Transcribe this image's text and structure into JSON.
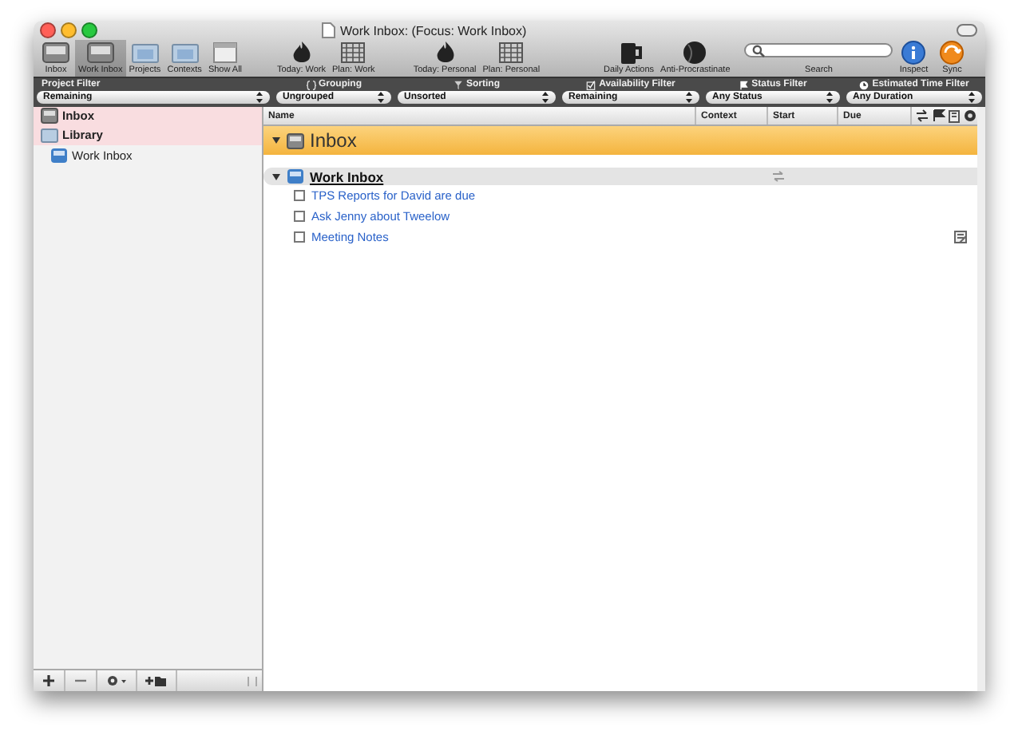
{
  "window": {
    "title": "Work Inbox: (Focus: Work Inbox)"
  },
  "toolbar": {
    "groups": [
      {
        "items": [
          {
            "label": "Inbox",
            "kind": "tray",
            "selected": false
          },
          {
            "label": "Work Inbox",
            "kind": "tray",
            "selected": true
          },
          {
            "label": "Projects",
            "kind": "folder",
            "selected": false
          },
          {
            "label": "Contexts",
            "kind": "folder",
            "selected": false
          },
          {
            "label": "Show All",
            "kind": "window",
            "selected": false
          }
        ]
      },
      {
        "items": [
          {
            "label": "Today: Work",
            "kind": "flame",
            "selected": false
          },
          {
            "label": "Plan: Work",
            "kind": "calendar",
            "selected": false
          }
        ]
      },
      {
        "items": [
          {
            "label": "Today: Personal",
            "kind": "flame",
            "selected": false
          },
          {
            "label": "Plan: Personal",
            "kind": "calendar",
            "selected": false
          }
        ]
      },
      {
        "items": [
          {
            "label": "Daily Actions",
            "kind": "mug",
            "selected": false
          },
          {
            "label": "Anti-Procrastinate",
            "kind": "ball",
            "selected": false
          }
        ]
      }
    ],
    "search": {
      "label": "Search"
    },
    "right": [
      {
        "label": "Inspect",
        "kind": "info"
      },
      {
        "label": "Sync",
        "kind": "sync"
      }
    ]
  },
  "filters": [
    {
      "heading": "Project Filter",
      "kind": "plain",
      "value": "Remaining"
    },
    {
      "heading": "Grouping",
      "kind": "braces",
      "value": "Ungrouped"
    },
    {
      "heading": "Sorting",
      "kind": "funnel",
      "value": "Unsorted"
    },
    {
      "heading": "Availability Filter",
      "kind": "check",
      "value": "Remaining"
    },
    {
      "heading": "Status Filter",
      "kind": "flag",
      "value": "Any Status"
    },
    {
      "heading": "Estimated Time Filter",
      "kind": "clock",
      "value": "Any Duration"
    }
  ],
  "sidebar": {
    "items": [
      {
        "label": "Inbox",
        "kind": "tray",
        "selected": true
      },
      {
        "label": "Library",
        "kind": "folder",
        "selected": true,
        "children": [
          {
            "label": "Work Inbox",
            "kind": "blue-tray",
            "selected": false
          }
        ]
      }
    ]
  },
  "table": {
    "columns": [
      "Name",
      "Context",
      "Start",
      "Due"
    ],
    "inbox_heading": "Inbox",
    "groups": [
      {
        "title": "Work Inbox",
        "expanded": true,
        "tasks": [
          {
            "name": "TPS Reports for David are due",
            "checked": false,
            "has_note": false
          },
          {
            "name": "Ask Jenny about Tweelow",
            "checked": false,
            "has_note": false
          },
          {
            "name": "Meeting Notes",
            "checked": false,
            "has_note": true
          }
        ]
      }
    ]
  }
}
